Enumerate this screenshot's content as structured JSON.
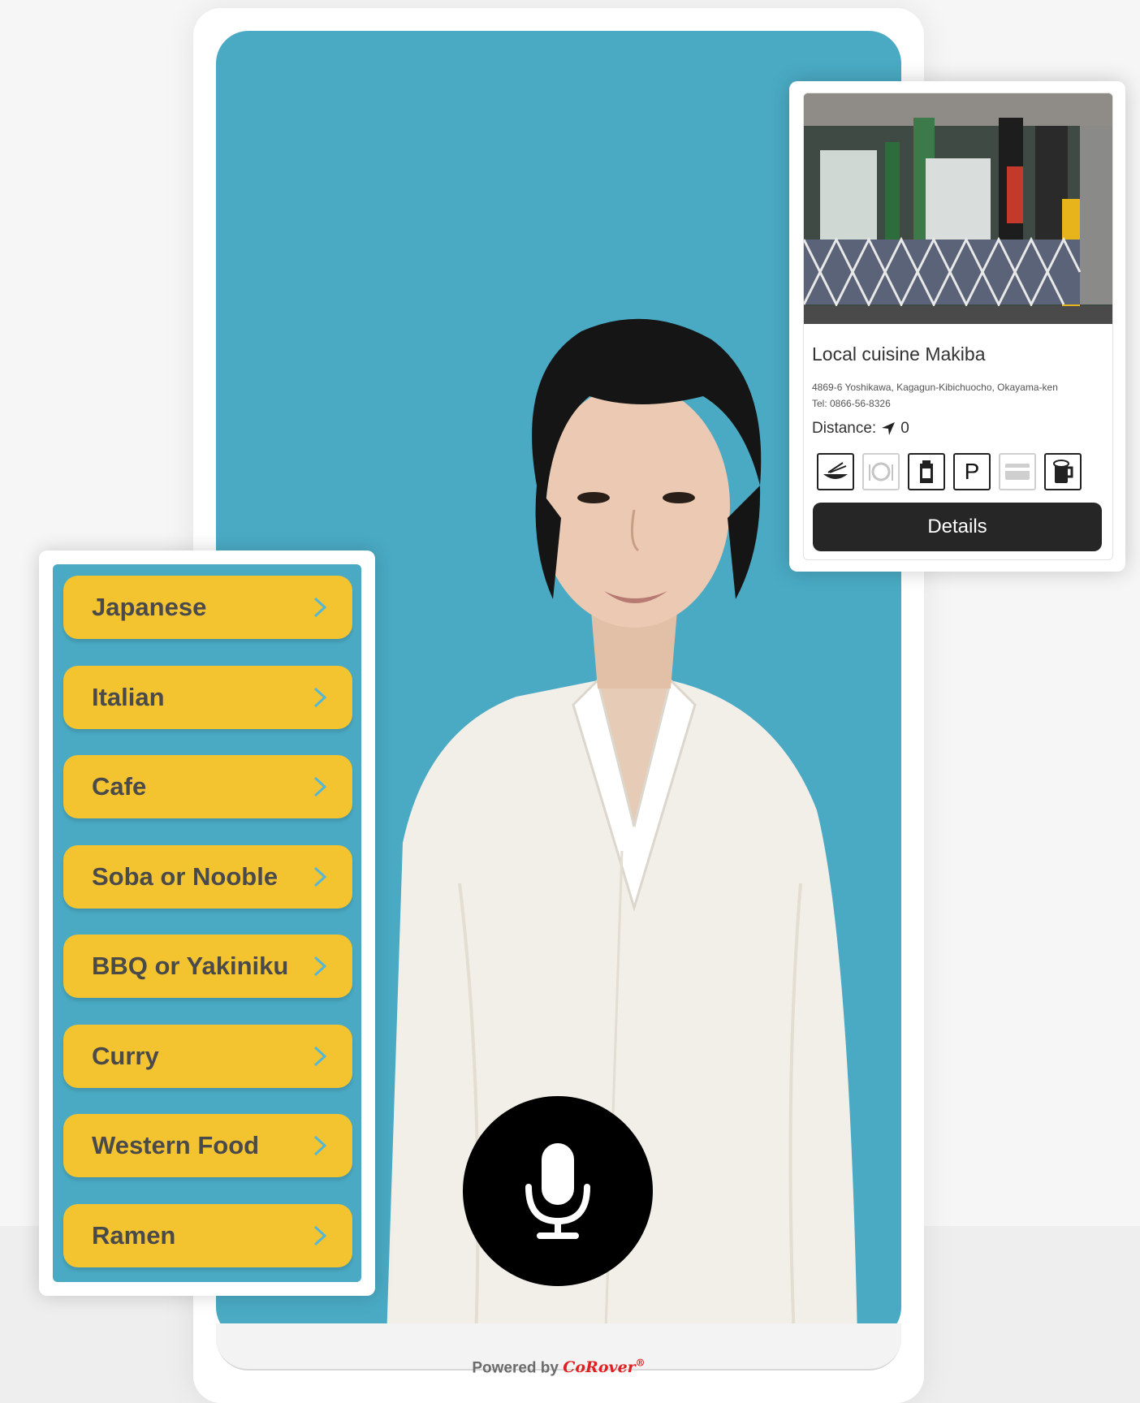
{
  "categories": [
    {
      "label": "Japanese"
    },
    {
      "label": "Italian"
    },
    {
      "label": "Cafe"
    },
    {
      "label": "Soba or Nooble"
    },
    {
      "label": "BBQ or Yakiniku"
    },
    {
      "label": "Curry"
    },
    {
      "label": "Western Food"
    },
    {
      "label": "Ramen"
    }
  ],
  "restaurant": {
    "name": "Local cuisine Makiba",
    "address": "4869-6 Yoshikawa, Kagagun-Kibichuocho, Okayama-ken",
    "tel": "Tel: 0866-56-8326",
    "distance_label": "Distance:",
    "distance_value": "0",
    "amenities": [
      "noodle-icon",
      "dining-icon",
      "takeout-icon",
      "parking-icon",
      "card-icon",
      "beer-icon"
    ],
    "amenity_parking_label": "P",
    "details_label": "Details"
  },
  "footer": {
    "powered_by": "Powered by",
    "brand": "CoRover"
  },
  "colors": {
    "stage": "#4aaac4",
    "category_button": "#f4c430",
    "category_text": "#4a4a4a",
    "chevron": "#55b6d6",
    "details_button": "#262626",
    "mic_button": "#000000",
    "brand": "#e02020"
  }
}
